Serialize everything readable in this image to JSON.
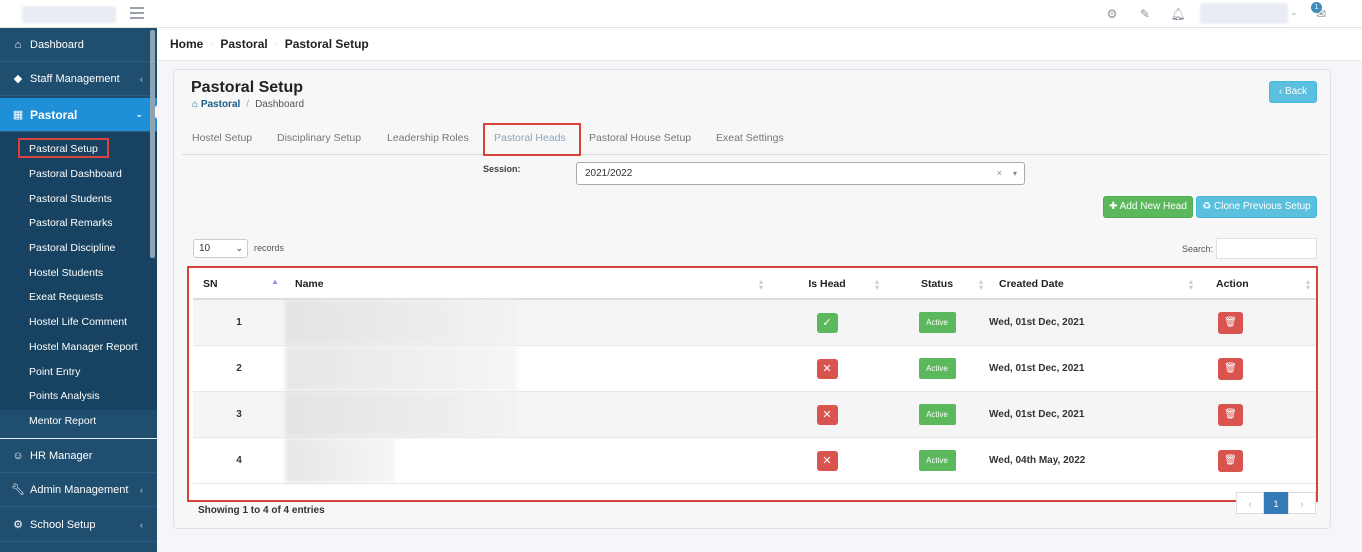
{
  "topbar": {
    "icons": [
      "gear-icon",
      "edit-icon",
      "bell-icon",
      "mail-icon"
    ],
    "notification_count": "1"
  },
  "sidebar": {
    "items": [
      {
        "label": "Dashboard",
        "icon": "home-icon"
      },
      {
        "label": "Staff Management",
        "icon": "diamond-icon"
      },
      {
        "label": "Pastoral",
        "icon": "table-icon"
      },
      {
        "label": "HR Manager",
        "icon": "users-icon"
      },
      {
        "label": "Admin Management",
        "icon": "wrench-icon"
      },
      {
        "label": "School Setup",
        "icon": "gear-icon"
      }
    ],
    "submenu": [
      "Pastoral Setup",
      "Pastoral Dashboard",
      "Pastoral Students",
      "Pastoral Remarks",
      "Pastoral Discipline",
      "Hostel Students",
      "Exeat Requests",
      "Hostel Life Comment",
      "Hostel Manager Report",
      "Point Entry",
      "Points Analysis",
      "Mentor Report"
    ]
  },
  "breadcrumb": [
    "Home",
    "Pastoral",
    "Pastoral Setup"
  ],
  "panel": {
    "title": "Pastoral Setup",
    "sub_home": "Pastoral",
    "sub_current": "Dashboard",
    "back_label": "Back"
  },
  "tabs": [
    "Hostel Setup",
    "Disciplinary Setup",
    "Leadership Roles",
    "Pastoral Heads",
    "Pastoral House Setup",
    "Exeat Settings"
  ],
  "session": {
    "label": "Session:",
    "value": "2021/2022"
  },
  "buttons": {
    "add": "Add New Head",
    "clone": "Clone Previous Setup"
  },
  "table_controls": {
    "length": "10",
    "length_label": "records",
    "search_label": "Search:"
  },
  "table": {
    "columns": [
      "SN",
      "Name",
      "Is Head",
      "Status",
      "Created Date",
      "Action"
    ],
    "rows": [
      {
        "sn": "1",
        "is_head": true,
        "status": "Active",
        "date": "Wed, 01st Dec, 2021"
      },
      {
        "sn": "2",
        "is_head": false,
        "status": "Active",
        "date": "Wed, 01st Dec, 2021"
      },
      {
        "sn": "3",
        "is_head": false,
        "status": "Active",
        "date": "Wed, 01st Dec, 2021"
      },
      {
        "sn": "4",
        "is_head": false,
        "status": "Active",
        "date": "Wed, 04th May, 2022"
      }
    ]
  },
  "footer": {
    "showing": "Showing 1 to 4 of 4 entries",
    "pages": [
      "‹",
      "1",
      "›"
    ]
  }
}
